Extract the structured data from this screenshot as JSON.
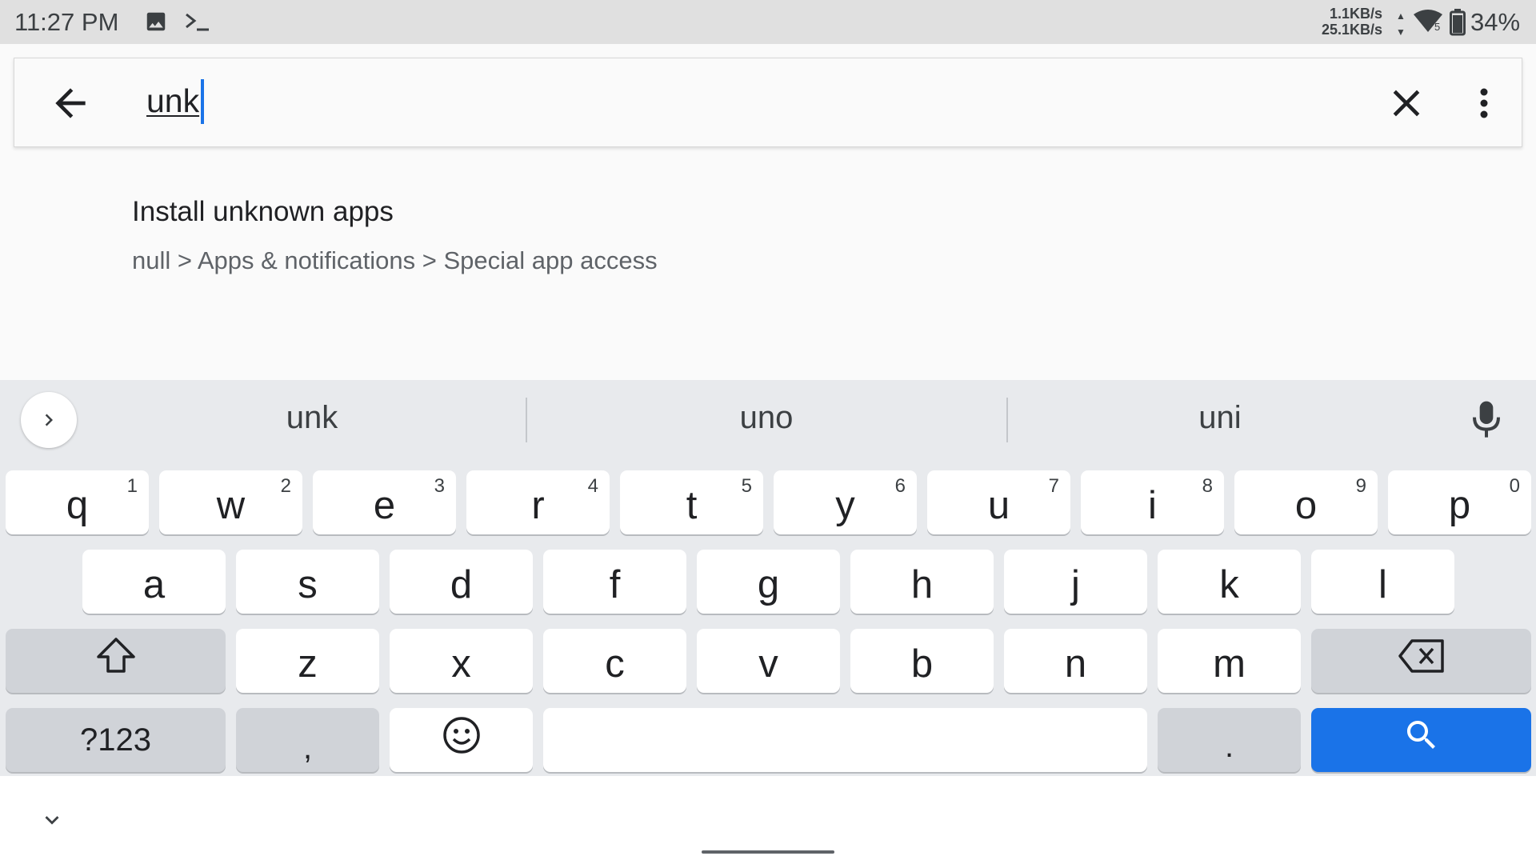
{
  "status_bar": {
    "time": "11:27 PM",
    "upload_speed": "1.1KB/s",
    "download_speed": "25.1KB/s",
    "up_arrow": "▲",
    "down_arrow": "▼",
    "wifi_badge": "5",
    "battery_percent": "34%"
  },
  "search": {
    "query": "unk"
  },
  "results": [
    {
      "title": "Install unknown apps",
      "path": "null > Apps & notifications > Special app access"
    }
  ],
  "keyboard": {
    "suggestions": [
      "unk",
      "uno",
      "uni"
    ],
    "row1": [
      {
        "key": "q",
        "hint": "1"
      },
      {
        "key": "w",
        "hint": "2"
      },
      {
        "key": "e",
        "hint": "3"
      },
      {
        "key": "r",
        "hint": "4"
      },
      {
        "key": "t",
        "hint": "5"
      },
      {
        "key": "y",
        "hint": "6"
      },
      {
        "key": "u",
        "hint": "7"
      },
      {
        "key": "i",
        "hint": "8"
      },
      {
        "key": "o",
        "hint": "9"
      },
      {
        "key": "p",
        "hint": "0"
      }
    ],
    "row2": [
      "a",
      "s",
      "d",
      "f",
      "g",
      "h",
      "j",
      "k",
      "l"
    ],
    "row3": [
      "z",
      "x",
      "c",
      "v",
      "b",
      "n",
      "m"
    ],
    "symbols_label": "?123",
    "comma_label": ",",
    "period_label": ".",
    "accent_color": "#1a73e8"
  },
  "icons": {
    "status": [
      "image-icon",
      "terminal-icon",
      "wifi-icon",
      "battery-icon"
    ],
    "search_bar": [
      "back-arrow-icon",
      "close-icon",
      "more-vert-icon"
    ],
    "keyboard": [
      "chevron-right-icon",
      "mic-icon",
      "shift-icon",
      "backspace-icon",
      "emoji-icon",
      "search-icon"
    ],
    "nav": [
      "chevron-down-icon"
    ]
  }
}
